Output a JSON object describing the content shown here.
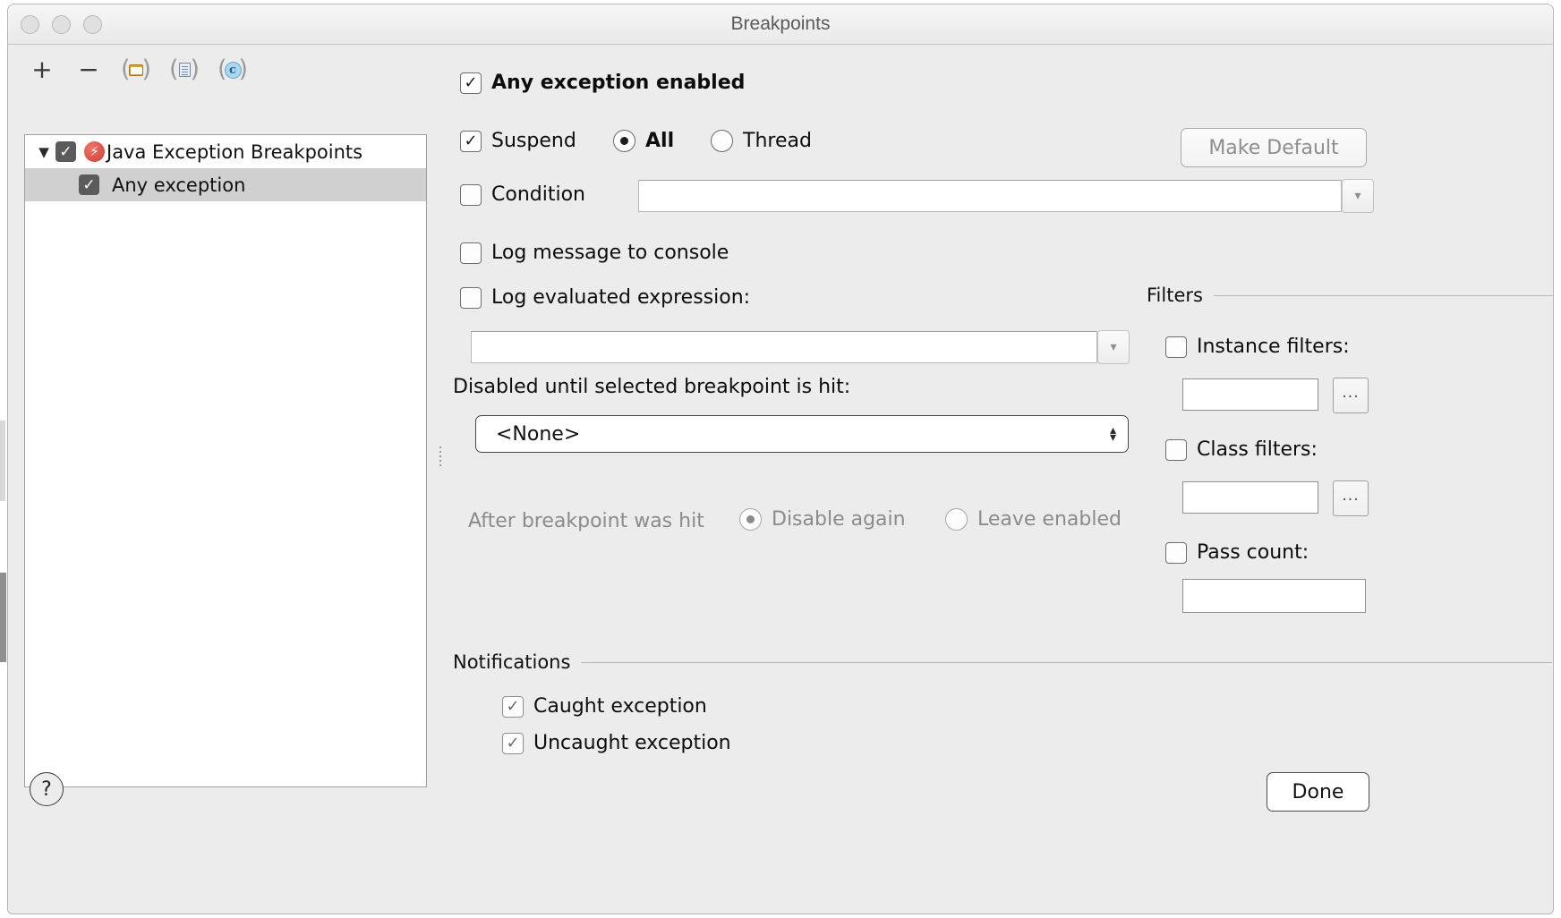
{
  "window": {
    "title": "Breakpoints",
    "traffic_lights": [
      "close",
      "minimize",
      "zoom"
    ]
  },
  "left_panel": {
    "toolbar": [
      {
        "name": "add",
        "glyph": "+"
      },
      {
        "name": "remove",
        "glyph": "−"
      },
      {
        "name": "folder-group",
        "glyph": "folder-icon"
      },
      {
        "name": "file-group",
        "glyph": "document-icon"
      },
      {
        "name": "copy-group",
        "glyph": "c-circle-icon"
      }
    ],
    "tree": [
      {
        "label": "Java Exception Breakpoints",
        "checked": true,
        "expanded": true,
        "selected": false,
        "level": 0,
        "icon": "exception-icon"
      },
      {
        "label": "Any exception",
        "checked": true,
        "selected": true,
        "level": 1
      }
    ]
  },
  "main": {
    "any_exception_enabled": {
      "label": "Any exception enabled",
      "checked": true
    },
    "suspend": {
      "label": "Suspend",
      "checked": true
    },
    "suspend_policy": {
      "options": [
        {
          "label": "All",
          "selected": true
        },
        {
          "label": "Thread",
          "selected": false
        }
      ]
    },
    "make_default": {
      "label": "Make Default",
      "enabled": false
    },
    "condition": {
      "label": "Condition",
      "checked": false,
      "value": "",
      "has_dropdown": true
    },
    "log_message": {
      "label": "Log message to console",
      "checked": false
    },
    "log_expression": {
      "label": "Log evaluated expression:",
      "checked": false,
      "value": "",
      "has_dropdown": true
    },
    "disabled_until": {
      "label": "Disabled until selected breakpoint is hit:",
      "value": "<None>",
      "options": [
        "<None>"
      ]
    },
    "after_hit": {
      "label": "After breakpoint was hit",
      "enabled": false,
      "options": [
        {
          "label": "Disable again",
          "selected": true
        },
        {
          "label": "Leave enabled",
          "selected": false
        }
      ]
    },
    "filters": {
      "title": "Filters",
      "instance": {
        "label": "Instance filters:",
        "checked": false,
        "value": "",
        "browse_label": "..."
      },
      "class": {
        "label": "Class filters:",
        "checked": false,
        "value": "",
        "browse_label": "..."
      },
      "pass_count": {
        "label": "Pass count:",
        "checked": false,
        "value": ""
      }
    },
    "notifications": {
      "title": "Notifications",
      "items": [
        {
          "label": "Caught exception",
          "checked": true
        },
        {
          "label": "Uncaught exception",
          "checked": true
        }
      ]
    }
  },
  "footer": {
    "help_label": "?",
    "done_label": "Done"
  },
  "glyphs": {
    "check": "✓",
    "triangle_down": "▼",
    "small_triangle_down": "▾",
    "stepper_up": "▴",
    "stepper_down": "▾",
    "exception_bolt": "⚡",
    "plus": "+",
    "minus": "−",
    "c": "c"
  },
  "colors": {
    "window_bg": "#ececec",
    "panel_bg": "#ffffff",
    "selection": "#d0d0d0",
    "tree_checkbox": "#5b5b5b",
    "exception_red": "#cf3f34",
    "folder_orange": "#dba23a",
    "c_blue": "#a8d8f0",
    "disabled_text": "#8b8b8b",
    "title_text": "#5b5b5b"
  }
}
